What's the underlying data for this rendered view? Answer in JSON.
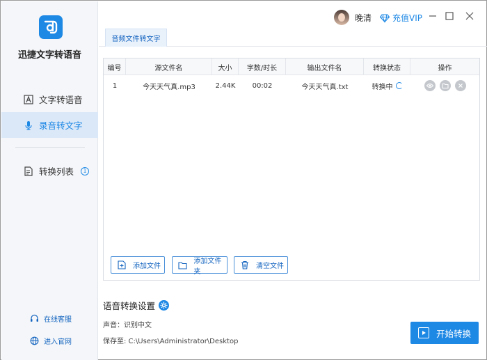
{
  "app": {
    "title": "迅捷文字转语音"
  },
  "sidebar": {
    "items": [
      {
        "label": "文字转语音",
        "icon": "text-a-icon"
      },
      {
        "label": "录音转文字",
        "icon": "microphone-icon"
      },
      {
        "label": "转换列表",
        "icon": "list-doc-icon",
        "count": "1"
      }
    ],
    "links": [
      {
        "label": "在线客服",
        "icon": "headset-icon"
      },
      {
        "label": "进入官网",
        "icon": "globe-icon"
      }
    ]
  },
  "header": {
    "username": "晚清",
    "vip_label": "充值VIP",
    "window_controls": [
      "minimize-icon",
      "maximize-icon",
      "close-icon"
    ]
  },
  "tabs": [
    {
      "label": "音频文件转文字"
    }
  ],
  "table": {
    "columns": [
      "编号",
      "源文件名",
      "大小",
      "字数/时长",
      "输出文件名",
      "转换状态",
      "操作"
    ],
    "rows": [
      {
        "index": "1",
        "source": "今天天气真.mp3",
        "size": "2.44K",
        "duration": "00:02",
        "output": "今天天气真.txt",
        "status": "转换中"
      }
    ],
    "operations": [
      "preview-eye-icon",
      "open-folder-icon",
      "delete-x-icon"
    ]
  },
  "actions": {
    "add_file": "添加文件",
    "add_folder": "添加文件夹",
    "clear_files": "清空文件"
  },
  "settings": {
    "title": "语音转换设置",
    "voice_line": "声音：识别中文",
    "save_line": "保存至: C:\\Users\\Administrator\\Desktop"
  },
  "start_button": "开始转换",
  "colors": {
    "accent": "#1e88e5",
    "sidebar_bg": "#f4f6f9",
    "active_bg": "#dbe8f8"
  }
}
